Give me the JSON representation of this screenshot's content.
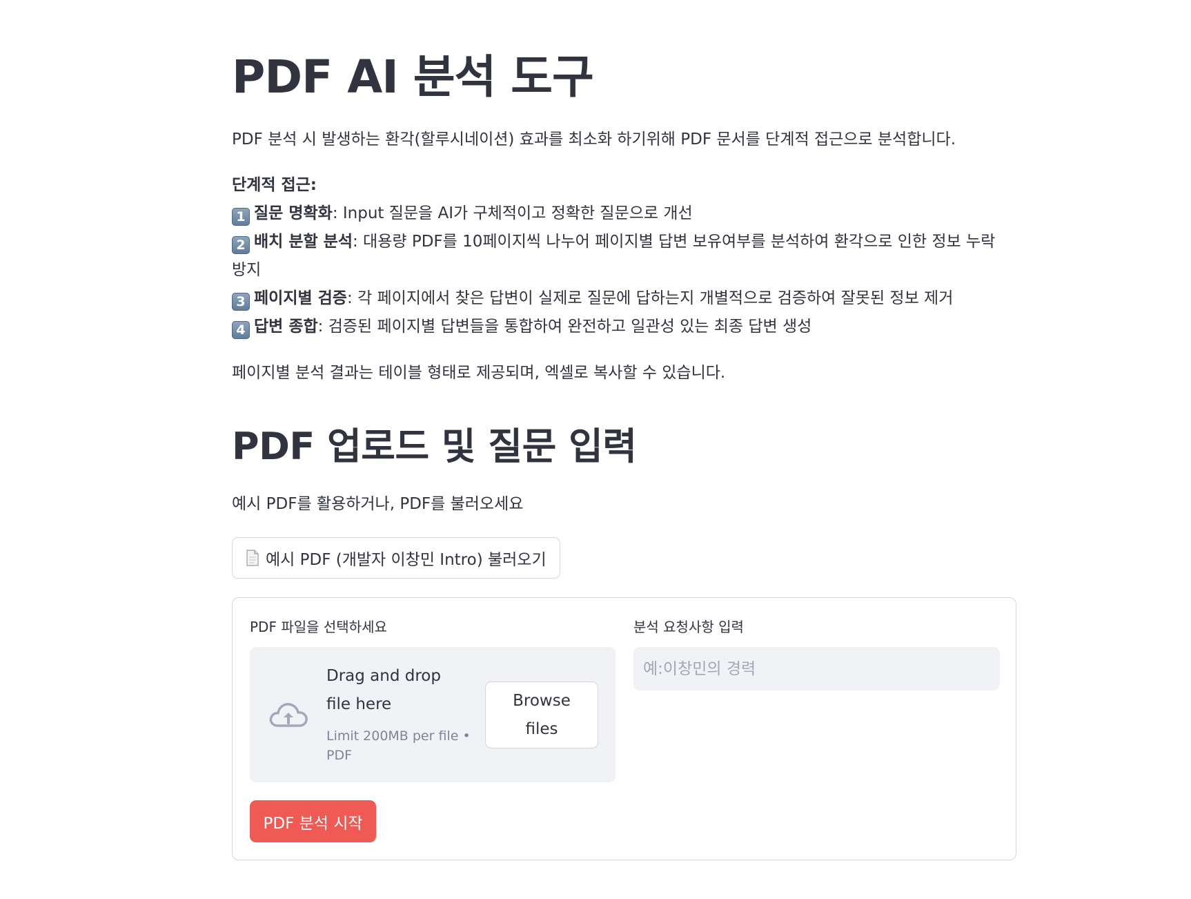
{
  "header": {
    "title": "PDF AI 분석 도구",
    "description": "PDF 분석 시 발생하는 환각(할루시네이션) 효과를 최소화 하기위해 PDF 문서를 단계적 접근으로 분석합니다."
  },
  "steps": {
    "heading": "단계적 접근:",
    "items": [
      {
        "num": "1",
        "title": "질문 명확화",
        "text": ": Input 질문을 AI가 구체적이고 정확한 질문으로 개선"
      },
      {
        "num": "2",
        "title": "배치 분할 분석",
        "text": ": 대용량 PDF를 10페이지씩 나누어 페이지별 답변 보유여부를 분석하여 환각으로 인한 정보 누락",
        "text_cont": "방지"
      },
      {
        "num": "3",
        "title": "페이지별 검증",
        "text": ": 각 페이지에서 찾은 답변이 실제로 질문에 답하는지 개별적으로 검증하여 잘못된 정보 제거"
      },
      {
        "num": "4",
        "title": "답변 종합",
        "text": ": 검증된 페이지별 답변들을 통합하여 완전하고 일관성 있는 최종 답변 생성"
      }
    ],
    "footer": "페이지별 분석 결과는 테이블 형태로 제공되며, 엑셀로 복사할 수 있습니다."
  },
  "upload": {
    "title": "PDF 업로드 및 질문 입력",
    "subtitle": "예시 PDF를 활용하거나, PDF를 불러오세요",
    "example_button": "예시 PDF (개발자 이창민 Intro) 불러오기",
    "file_label": "PDF 파일을 선택하세요",
    "dropzone_title": "Drag and drop file here",
    "dropzone_limit": "Limit 200MB per file • PDF",
    "browse_button": "Browse files",
    "query_label": "분석 요청사항 입력",
    "query_placeholder": "예:이창민의 경력",
    "query_value": "",
    "start_button": "PDF 분석 시작"
  },
  "colors": {
    "text": "#31333f",
    "primary_button": "#ef5a55",
    "input_bg": "#f0f2f6",
    "muted": "#808495"
  }
}
